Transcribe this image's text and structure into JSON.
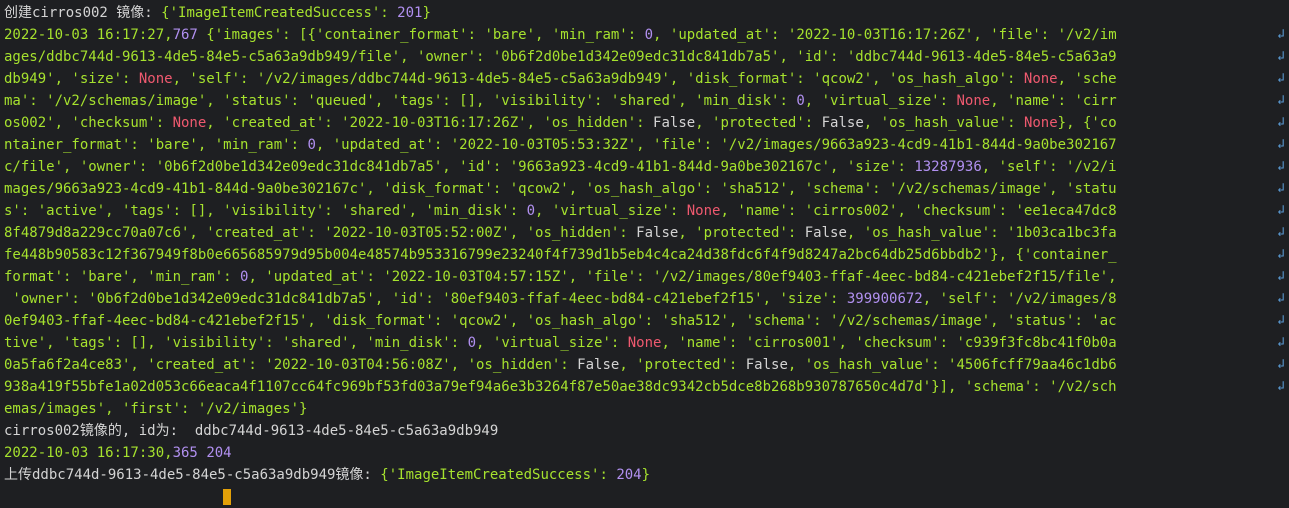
{
  "palette": {
    "default": "#d4d4d4",
    "str": "#a6e22e",
    "num": "#b190f0",
    "kw": "#ef596f",
    "wrap": "#5a9bd5",
    "cursor": "#e3a008"
  },
  "terminal": {
    "lines": [
      {
        "wrap": false,
        "s": [
          [
            "d",
            "创建cirros002 镜像: "
          ],
          [
            "s",
            "{'ImageItemCreatedSuccess': "
          ],
          [
            "n",
            "201"
          ],
          [
            "s",
            "}"
          ]
        ]
      },
      {
        "wrap": true,
        "s": [
          [
            "s",
            "2022-10-03 16:17:27,"
          ],
          [
            "n",
            "767"
          ],
          [
            "s",
            " {'images': [{'container_format': 'bare', 'min_ram': "
          ],
          [
            "n",
            "0"
          ],
          [
            "s",
            ", 'updated_at': '2022-10-03T16:17:26Z', 'file': '/v2/im"
          ]
        ]
      },
      {
        "wrap": true,
        "s": [
          [
            "s",
            "ages/ddbc744d-9613-4de5-84e5-c5a63a9db949/file', 'owner': '0b6f2d0be1d342e09edc31dc841db7a5', 'id': 'ddbc744d-9613-4de5-84e5-c5a63a9"
          ]
        ]
      },
      {
        "wrap": true,
        "s": [
          [
            "s",
            "db949', 'size': "
          ],
          [
            "k",
            "None"
          ],
          [
            "s",
            ", 'self': '/v2/images/ddbc744d-9613-4de5-84e5-c5a63a9db949', 'disk_format': 'qcow2', 'os_hash_algo': "
          ],
          [
            "k",
            "None"
          ],
          [
            "s",
            ", 'sche"
          ]
        ]
      },
      {
        "wrap": true,
        "s": [
          [
            "s",
            "ma': '/v2/schemas/image', 'status': 'queued', 'tags': [], 'visibility': 'shared', 'min_disk': "
          ],
          [
            "n",
            "0"
          ],
          [
            "s",
            ", 'virtual_size': "
          ],
          [
            "k",
            "None"
          ],
          [
            "s",
            ", 'name': 'cirr"
          ]
        ]
      },
      {
        "wrap": true,
        "s": [
          [
            "s",
            "os002', 'checksum': "
          ],
          [
            "k",
            "None"
          ],
          [
            "s",
            ", 'created_at': '2022-10-03T16:17:26Z', 'os_hidden': "
          ],
          [
            "d",
            "False"
          ],
          [
            "s",
            ", 'protected': "
          ],
          [
            "d",
            "False"
          ],
          [
            "s",
            ", 'os_hash_value': "
          ],
          [
            "k",
            "None"
          ],
          [
            "s",
            "}, {'co"
          ]
        ]
      },
      {
        "wrap": true,
        "s": [
          [
            "s",
            "ntainer_format': 'bare', 'min_ram': "
          ],
          [
            "n",
            "0"
          ],
          [
            "s",
            ", 'updated_at': '2022-10-03T05:53:32Z', 'file': '/v2/images/9663a923-4cd9-41b1-844d-9a0be302167"
          ]
        ]
      },
      {
        "wrap": true,
        "s": [
          [
            "s",
            "c/file', 'owner': '0b6f2d0be1d342e09edc31dc841db7a5', 'id': '9663a923-4cd9-41b1-844d-9a0be302167c', 'size': "
          ],
          [
            "n",
            "13287936"
          ],
          [
            "s",
            ", 'self': '/v2/i"
          ]
        ]
      },
      {
        "wrap": true,
        "s": [
          [
            "s",
            "mages/9663a923-4cd9-41b1-844d-9a0be302167c', 'disk_format': 'qcow2', 'os_hash_algo': 'sha512', 'schema': '/v2/schemas/image', 'statu"
          ]
        ]
      },
      {
        "wrap": true,
        "s": [
          [
            "s",
            "s': 'active', 'tags': [], 'visibility': 'shared', 'min_disk': "
          ],
          [
            "n",
            "0"
          ],
          [
            "s",
            ", 'virtual_size': "
          ],
          [
            "k",
            "None"
          ],
          [
            "s",
            ", 'name': 'cirros002', 'checksum': 'ee1eca47dc8"
          ]
        ]
      },
      {
        "wrap": true,
        "s": [
          [
            "s",
            "8f4879d8a229cc70a07c6', 'created_at': '2022-10-03T05:52:00Z', 'os_hidden': "
          ],
          [
            "d",
            "False"
          ],
          [
            "s",
            ", 'protected': "
          ],
          [
            "d",
            "False"
          ],
          [
            "s",
            ", 'os_hash_value': '1b03ca1bc3fa"
          ]
        ]
      },
      {
        "wrap": true,
        "s": [
          [
            "s",
            "fe448b90583c12f367949f8b0e665685979d95b004e48574b953316799e23240f4f739d1b5eb4c4ca24d38fdc6f4f9d8247a2bc64db25d6bbdb2'}, {'container_"
          ]
        ]
      },
      {
        "wrap": true,
        "s": [
          [
            "s",
            "format': 'bare', 'min_ram': "
          ],
          [
            "n",
            "0"
          ],
          [
            "s",
            ", 'updated_at': '2022-10-03T04:57:15Z', 'file': '/v2/images/80ef9403-ffaf-4eec-bd84-c421ebef2f15/file',"
          ]
        ]
      },
      {
        "wrap": true,
        "s": [
          [
            "s",
            " 'owner': '0b6f2d0be1d342e09edc31dc841db7a5', 'id': '80ef9403-ffaf-4eec-bd84-c421ebef2f15', 'size': "
          ],
          [
            "n",
            "399900672"
          ],
          [
            "s",
            ", 'self': '/v2/images/8"
          ]
        ]
      },
      {
        "wrap": true,
        "s": [
          [
            "s",
            "0ef9403-ffaf-4eec-bd84-c421ebef2f15', 'disk_format': 'qcow2', 'os_hash_algo': 'sha512', 'schema': '/v2/schemas/image', 'status': 'ac"
          ]
        ]
      },
      {
        "wrap": true,
        "s": [
          [
            "s",
            "tive', 'tags': [], 'visibility': 'shared', 'min_disk': "
          ],
          [
            "n",
            "0"
          ],
          [
            "s",
            ", 'virtual_size': "
          ],
          [
            "k",
            "None"
          ],
          [
            "s",
            ", 'name': 'cirros001', 'checksum': 'c939f3fc8bc41f0b0a"
          ]
        ]
      },
      {
        "wrap": true,
        "s": [
          [
            "s",
            "0a5fa6f2a4ce83', 'created_at': '2022-10-03T04:56:08Z', 'os_hidden': "
          ],
          [
            "d",
            "False"
          ],
          [
            "s",
            ", 'protected': "
          ],
          [
            "d",
            "False"
          ],
          [
            "s",
            ", 'os_hash_value': '4506fcff79aa46c1db6"
          ]
        ]
      },
      {
        "wrap": true,
        "s": [
          [
            "s",
            "938a419f55bfe1a02d053c66eaca4f1107cc64fc969bf53fd03a79ef94a6e3b3264f87e50ae38dc9342cb5dce8b268b930787650c4d7d'}], 'schema': '/v2/sch"
          ]
        ]
      },
      {
        "wrap": false,
        "s": [
          [
            "s",
            "emas/images', 'first': '/v2/images'}"
          ]
        ]
      },
      {
        "wrap": false,
        "s": [
          [
            "d",
            "cirros002镜像的, id为:  ddbc744d-9613-4de5-84e5-c5a63a9db949"
          ]
        ]
      },
      {
        "wrap": false,
        "s": [
          [
            "s",
            "2022-10-03 16:17:30,"
          ],
          [
            "n",
            "365"
          ],
          [
            "s",
            " "
          ],
          [
            "n",
            "204"
          ]
        ]
      },
      {
        "wrap": false,
        "s": [
          [
            "d",
            "上传ddbc744d-9613-4de5-84e5-c5a63a9db949镜像: "
          ],
          [
            "s",
            "{'ImageItemCreatedSuccess': "
          ],
          [
            "n",
            "204"
          ],
          [
            "s",
            "}"
          ]
        ]
      }
    ],
    "wrap_icon": "↲",
    "cursor_icon": "block-cursor"
  }
}
